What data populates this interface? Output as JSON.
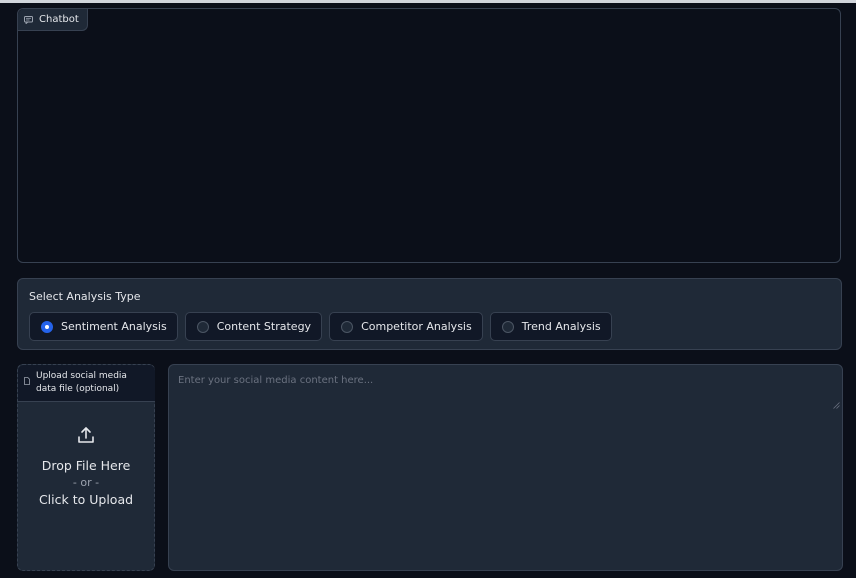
{
  "chatbot": {
    "label": "Chatbot",
    "icon": "chat-icon"
  },
  "analysis": {
    "title": "Select Analysis Type",
    "options": [
      {
        "label": "Sentiment Analysis",
        "selected": true
      },
      {
        "label": "Content Strategy",
        "selected": false
      },
      {
        "label": "Competitor Analysis",
        "selected": false
      },
      {
        "label": "Trend Analysis",
        "selected": false
      }
    ]
  },
  "upload": {
    "label": "Upload social media data file (optional)",
    "icon": "upload-icon",
    "drop_text": "Drop File Here",
    "or_text": "- or -",
    "click_text": "Click to Upload"
  },
  "content_input": {
    "placeholder": "Enter your social media content here...",
    "value": ""
  },
  "colors": {
    "background": "#0b0f19",
    "panel": "#1f2937",
    "border": "#374151",
    "accent": "#2563eb"
  }
}
